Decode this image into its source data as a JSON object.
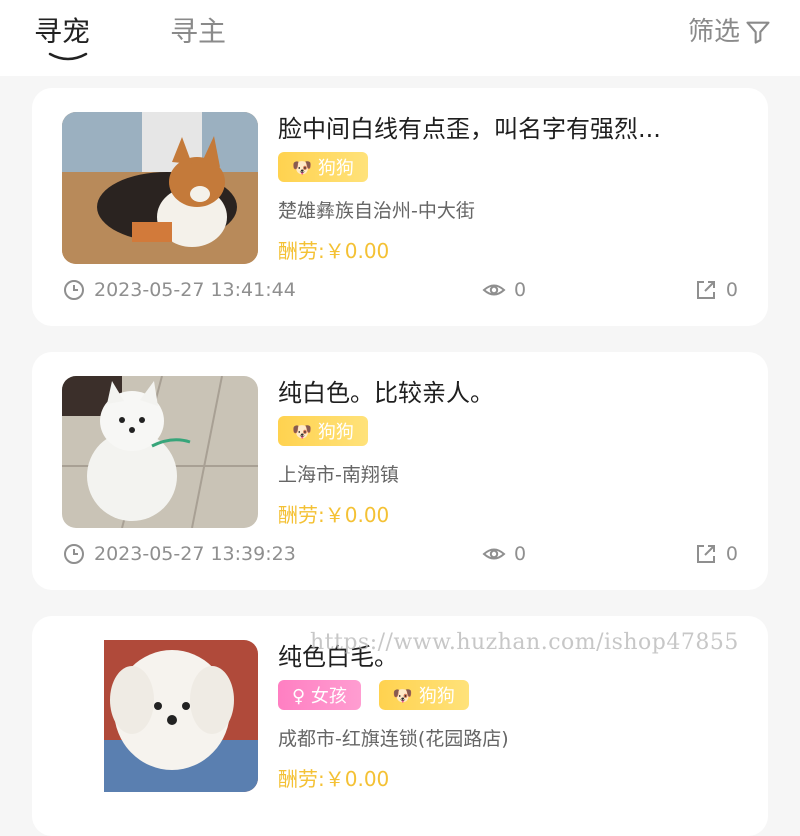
{
  "tabs": {
    "active": "寻宠",
    "inactive": "寻主"
  },
  "filter": {
    "label": "筛选",
    "icon": "filter-icon"
  },
  "cards": [
    {
      "title": "脸中间白线有点歪，叫名字有强烈...",
      "tags": [
        "狗狗"
      ],
      "location": "楚雄彝族自治州-中大街",
      "reward": "酬劳:￥0.00",
      "time": "2023-05-27 13:41:44",
      "views": "0",
      "shares": "0"
    },
    {
      "title": "纯白色。比较亲人。",
      "tags": [
        "狗狗"
      ],
      "location": "上海市-南翔镇",
      "reward": "酬劳:￥0.00",
      "time": "2023-05-27 13:39:23",
      "views": "0",
      "shares": "0"
    },
    {
      "title": "纯色白毛。",
      "tags": [
        "♀ 女孩",
        "狗狗"
      ],
      "location": "成都市-红旗连锁(花园路店)",
      "reward": "酬劳:￥0.00"
    }
  ],
  "watermark": "https://www.huzhan.com/ishop47855",
  "colors": {
    "accent": "#f4c134",
    "tag_dog": "#ffd24f",
    "tag_girl": "#ff7fc2",
    "muted": "#8f8f8f"
  }
}
